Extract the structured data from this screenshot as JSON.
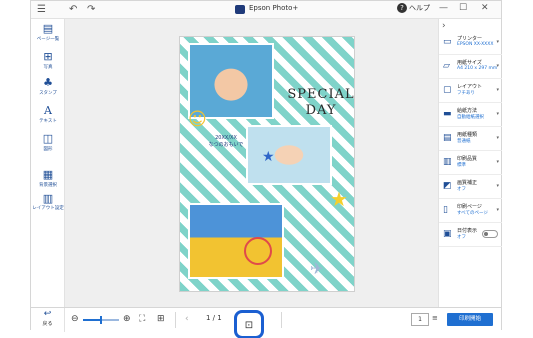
{
  "titlebar": {
    "app_title": "Epson Photo+",
    "help_label": "ヘルプ",
    "undo_icon": "undo-icon",
    "redo_icon": "redo-icon"
  },
  "left_tools": [
    {
      "name": "page-list",
      "label": "ページ一覧"
    },
    {
      "name": "photo",
      "label": "写真"
    },
    {
      "name": "stamp",
      "label": "スタンプ"
    },
    {
      "name": "text",
      "label": "テキスト"
    },
    {
      "name": "shape",
      "label": "図形"
    },
    {
      "name": "background",
      "label": "背景選択"
    },
    {
      "name": "layout",
      "label": "レイアウト設定"
    }
  ],
  "canvas": {
    "title_line1": "SPECIAL",
    "title_line2": "DAY",
    "caption_line1": "20XX/XX",
    "caption_line2": "なつのおもいで"
  },
  "right_panel": [
    {
      "label": "プリンター",
      "value": "EPSON XX-XXXX"
    },
    {
      "label": "用紙サイズ",
      "value": "A4 210 x 297 mm"
    },
    {
      "label": "レイアウト",
      "value": "フチあり"
    },
    {
      "label": "給紙方法",
      "value": "自動給紙選択"
    },
    {
      "label": "用紙種類",
      "value": "普通紙"
    },
    {
      "label": "印刷品質",
      "value": "標準"
    },
    {
      "label": "画質補正",
      "value": "オフ"
    },
    {
      "label": "印刷ページ",
      "value": "すべてのページ"
    },
    {
      "label": "日付表示",
      "value": "オフ"
    }
  ],
  "bottom": {
    "back_label": "戻る",
    "page_indicator": "1 / 1",
    "copies": "1",
    "print_button": "印刷開始",
    "zoom_level": 0.5
  },
  "colors": {
    "accent": "#1f6fd1",
    "highlight_ring": "#1b5fd1",
    "stripe": "#7fd3c9"
  }
}
